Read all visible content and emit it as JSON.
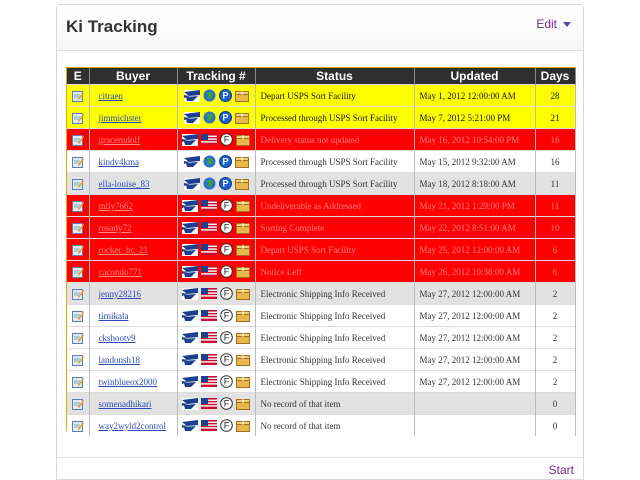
{
  "panel": {
    "title": "Ki Tracking",
    "edit_label": "Edit",
    "footer_link": "Start"
  },
  "colors": {
    "yellow_row": "#ffff00",
    "red_row": "#ff0000",
    "header_bg": "#2f2f2f",
    "accent_link": "#7a2a8c"
  },
  "table": {
    "columns": [
      "E",
      "Buyer",
      "Tracking #",
      "Status",
      "Updated",
      "Days"
    ],
    "rows": [
      {
        "style": "yellow",
        "buyer": "citraen",
        "carrier": "intl",
        "service": "P",
        "status": "Depart USPS Sort Facility",
        "updated": "May 1, 2012 12:00:00 AM",
        "days": "28"
      },
      {
        "style": "yellow",
        "buyer": "jimmichster",
        "carrier": "intl",
        "service": "P",
        "status": "Processed through USPS Sort Facility",
        "updated": "May 7, 2012 5:21:00 PM",
        "days": "21"
      },
      {
        "style": "red",
        "buyer": "gracerudolf",
        "carrier": "us",
        "service": "F",
        "status": "Delivery status not updated",
        "updated": "May 16, 2012 10:54:00 PM",
        "days": "16"
      },
      {
        "style": "white",
        "buyer": "kindv4kma",
        "carrier": "intl",
        "service": "P",
        "status": "Processed through USPS Sort Facility",
        "updated": "May 15, 2012 9:32:00 AM",
        "days": "16"
      },
      {
        "style": "grey",
        "buyer": "ella-louise_83",
        "carrier": "intl",
        "service": "P",
        "status": "Processed through USPS Sort Facility",
        "updated": "May 18, 2012 8:18:00 AM",
        "days": "11"
      },
      {
        "style": "red",
        "buyer": "mlly7662",
        "carrier": "us",
        "service": "F",
        "status": "Undeliverable as Addressed",
        "updated": "May 21, 2012 1:29:00 PM",
        "days": "11"
      },
      {
        "style": "red",
        "buyer": "rosady72",
        "carrier": "us",
        "service": "F",
        "status": "Sorting Complete",
        "updated": "May 22, 2012 8:51:00 AM",
        "days": "10"
      },
      {
        "style": "red",
        "buyer": "rocker_bc_21",
        "carrier": "us",
        "service": "F",
        "status": "Depart USPS Sort Facility",
        "updated": "May 25, 2012 12:00:00 AM",
        "days": "6"
      },
      {
        "style": "red",
        "buyer": "cacondo771",
        "carrier": "us",
        "service": "F",
        "status": "Notice Left",
        "updated": "May 26, 2012 10:38:00 AM",
        "days": "6"
      },
      {
        "style": "grey",
        "buyer": "jenny28216",
        "carrier": "us",
        "service": "F",
        "status": "Electronic Shipping Info Received",
        "updated": "May 27, 2012 12:00:00 AM",
        "days": "2"
      },
      {
        "style": "white",
        "buyer": "tirnikala",
        "carrier": "us",
        "service": "F",
        "status": "Electronic Shipping Info Received",
        "updated": "May 27, 2012 12:00:00 AM",
        "days": "2"
      },
      {
        "style": "white",
        "buyer": "ckshootv9",
        "carrier": "us",
        "service": "F",
        "status": "Electronic Shipping Info Received",
        "updated": "May 27, 2012 12:00:00 AM",
        "days": "2"
      },
      {
        "style": "white",
        "buyer": "landonsh18",
        "carrier": "us",
        "service": "F",
        "status": "Electronic Shipping Info Received",
        "updated": "May 27, 2012 12:00:00 AM",
        "days": "2"
      },
      {
        "style": "white",
        "buyer": "twinblueox2000",
        "carrier": "us",
        "service": "F",
        "status": "Electronic Shipping Info Received",
        "updated": "May 27, 2012 12:00:00 AM",
        "days": "2"
      },
      {
        "style": "grey",
        "buyer": "somenadhikari",
        "carrier": "us",
        "service": "F",
        "status": "No record of that item",
        "updated": "",
        "days": "0"
      },
      {
        "style": "white",
        "buyer": "way2wyld2control",
        "carrier": "us",
        "service": "F",
        "status": "No record of that item",
        "updated": "",
        "days": "0"
      }
    ]
  },
  "icons": {
    "edit": "edit-note-icon",
    "eagle": "usps-eagle-icon",
    "globe": "globe-icon",
    "flag": "us-flag-icon",
    "priority": "priority-mail-icon",
    "first_class": "first-class-mail-icon",
    "package": "package-icon"
  }
}
